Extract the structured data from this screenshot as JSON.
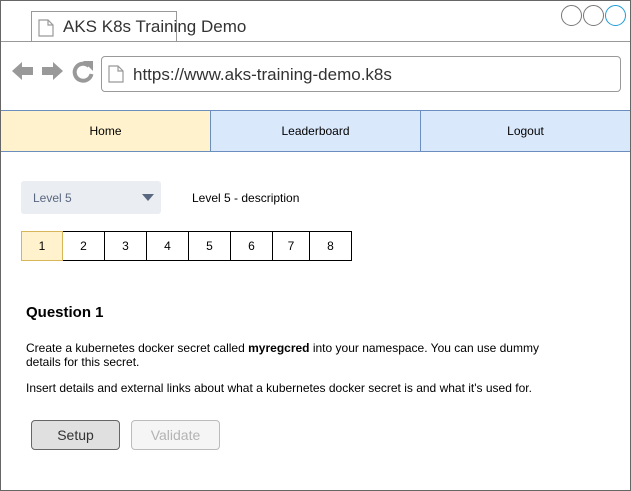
{
  "browser": {
    "tab_title": "AKS K8s Training Demo",
    "url": "https://www.aks-training-demo.k8s"
  },
  "menu": {
    "items": [
      {
        "label": "Home"
      },
      {
        "label": "Leaderboard"
      },
      {
        "label": "Logout"
      }
    ]
  },
  "level": {
    "selected": "Level 5",
    "description": "Level 5 - description"
  },
  "pager": {
    "pages": [
      "1",
      "2",
      "3",
      "4",
      "5",
      "6",
      "7",
      "8"
    ],
    "active": "1"
  },
  "question": {
    "title": "Question 1",
    "line1_before": "Create a kubernetes docker secret called ",
    "line1_bold": "myregcred",
    "line1_after": " into your namespace. You can use dummy details for this secret.",
    "line2": "Insert details and external links about what a kubernetes docker secret is and what it's used for."
  },
  "buttons": {
    "setup": "Setup",
    "validate": "Validate"
  },
  "colors": {
    "menu_active_bg": "#fff2cc",
    "menu_bg": "#dae8fc",
    "menu_border": "#6c8ebf",
    "page_active_border": "#d6b656",
    "select_bg": "#eaedf1",
    "window_control_accent": "#1e9bd7"
  },
  "icons": {
    "tab": "document-icon",
    "back": "back-arrow-icon",
    "forward": "forward-arrow-icon",
    "reload": "reload-icon",
    "url": "document-icon",
    "select": "chevron-down-icon"
  }
}
